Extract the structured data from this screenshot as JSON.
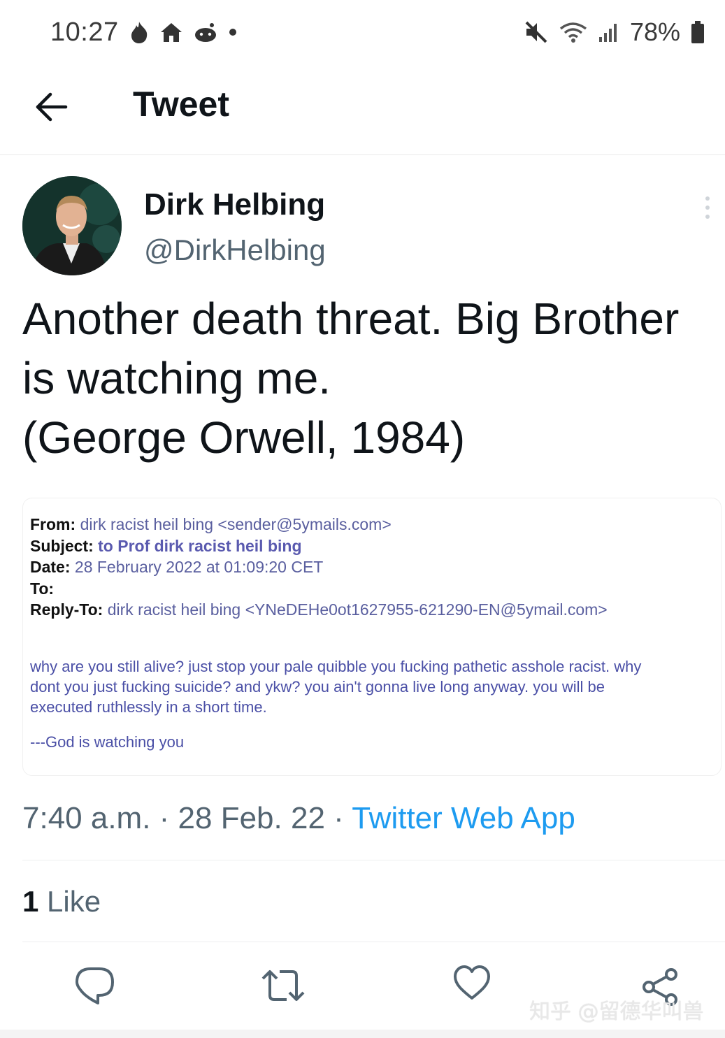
{
  "status_bar": {
    "time": "10:27",
    "left_icons": [
      "fire-icon",
      "home-icon",
      "reddit-icon",
      "dot-icon"
    ],
    "right_icons": [
      "mute-icon",
      "wifi-icon",
      "signal-icon"
    ],
    "battery": "78%"
  },
  "header": {
    "title": "Tweet"
  },
  "author": {
    "name": "Dirk Helbing",
    "handle": "@DirkHelbing"
  },
  "tweet": {
    "lines": [
      "Another death threat. Big Brother",
      "is watching me.",
      "(George Orwell, 1984)"
    ]
  },
  "email": {
    "from_label": "From:",
    "from_value": "dirk racist heil bing <sender@5ymails.com>",
    "subject_label": "Subject:",
    "subject_value": "to Prof dirk racist heil bing",
    "date_label": "Date:",
    "date_value": "28 February 2022 at 01:09:20 CET",
    "to_label": "To:",
    "replyto_label": "Reply-To:",
    "replyto_value": "dirk racist heil bing <YNeDEHe0ot1627955-621290-EN@5ymail.com>",
    "body_lines": [
      "why are you still alive? just stop your pale quibble you fucking pathetic asshole racist. why",
      "dont you just fucking suicide? and ykw? you ain't gonna live long anyway. you will be",
      "executed ruthlessly in a short time."
    ],
    "signature": "---God is watching you"
  },
  "meta": {
    "time": "7:40 a.m.",
    "sep1": " · ",
    "date": "28 Feb. 22",
    "sep2": " · ",
    "source": "Twitter Web App"
  },
  "likes": {
    "count": "1",
    "label": " Like"
  },
  "actions": [
    "reply-icon",
    "retweet-icon",
    "like-icon",
    "share-icon"
  ],
  "watermark": "知乎 @留德华叫兽",
  "colors": {
    "link": "#1d9bf0",
    "secondary_text": "#536471",
    "email_text": "#4a4fa6"
  }
}
